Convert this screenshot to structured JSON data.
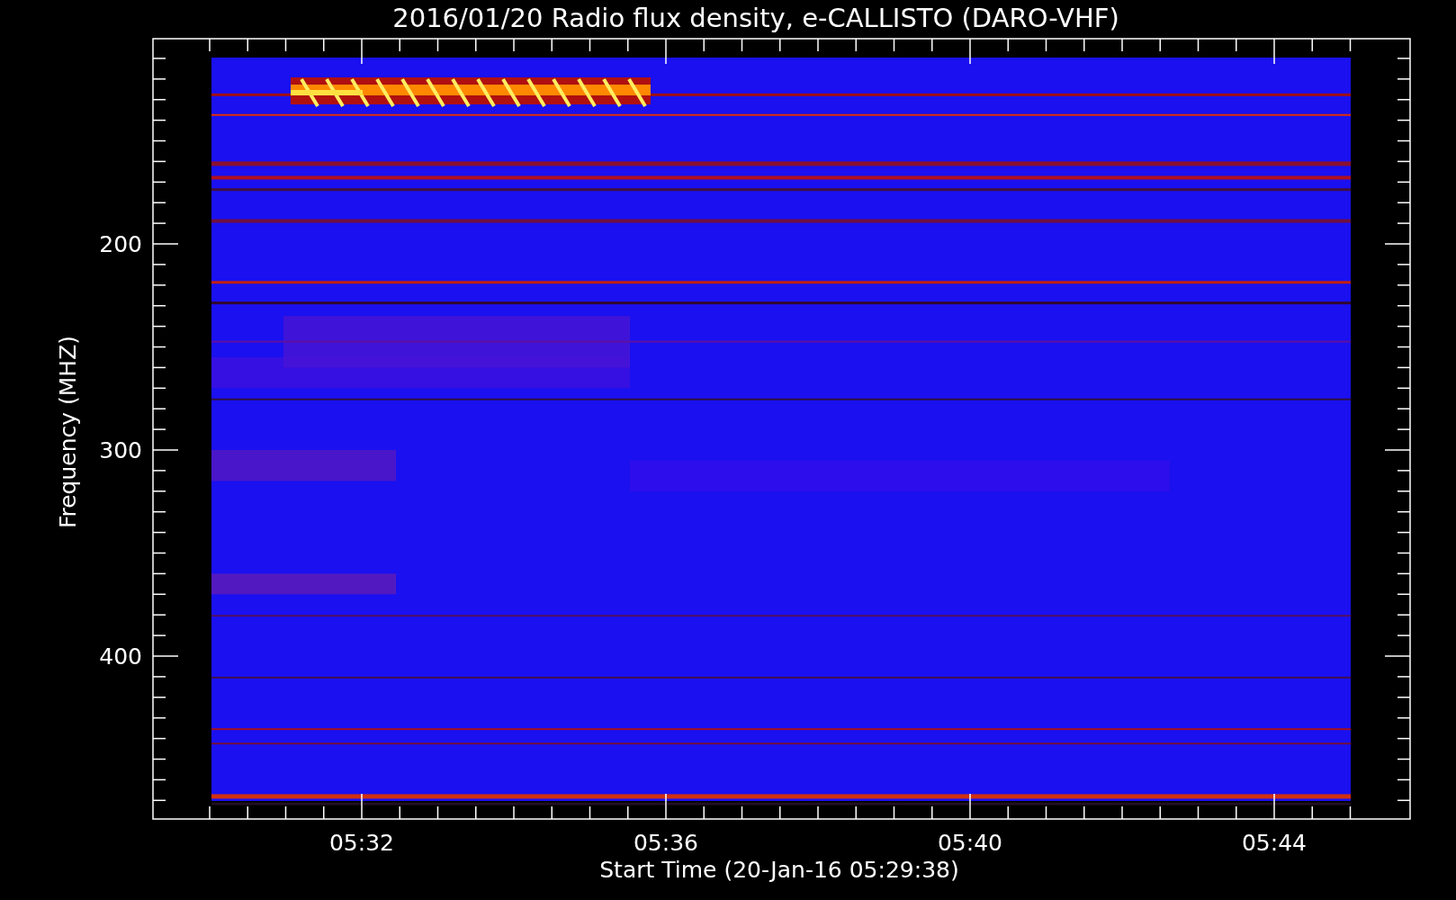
{
  "title": "2016/01/20  Radio flux density, e-CALLISTO (DARO-VHF)",
  "y_axis": {
    "label": "Frequency (MHZ)",
    "tick_labels": [
      "200",
      "300",
      "400"
    ]
  },
  "x_axis": {
    "label": "Start Time (20-Jan-16 05:29:38)",
    "tick_labels": [
      "05:32",
      "05:36",
      "05:40",
      "05:44"
    ]
  }
}
